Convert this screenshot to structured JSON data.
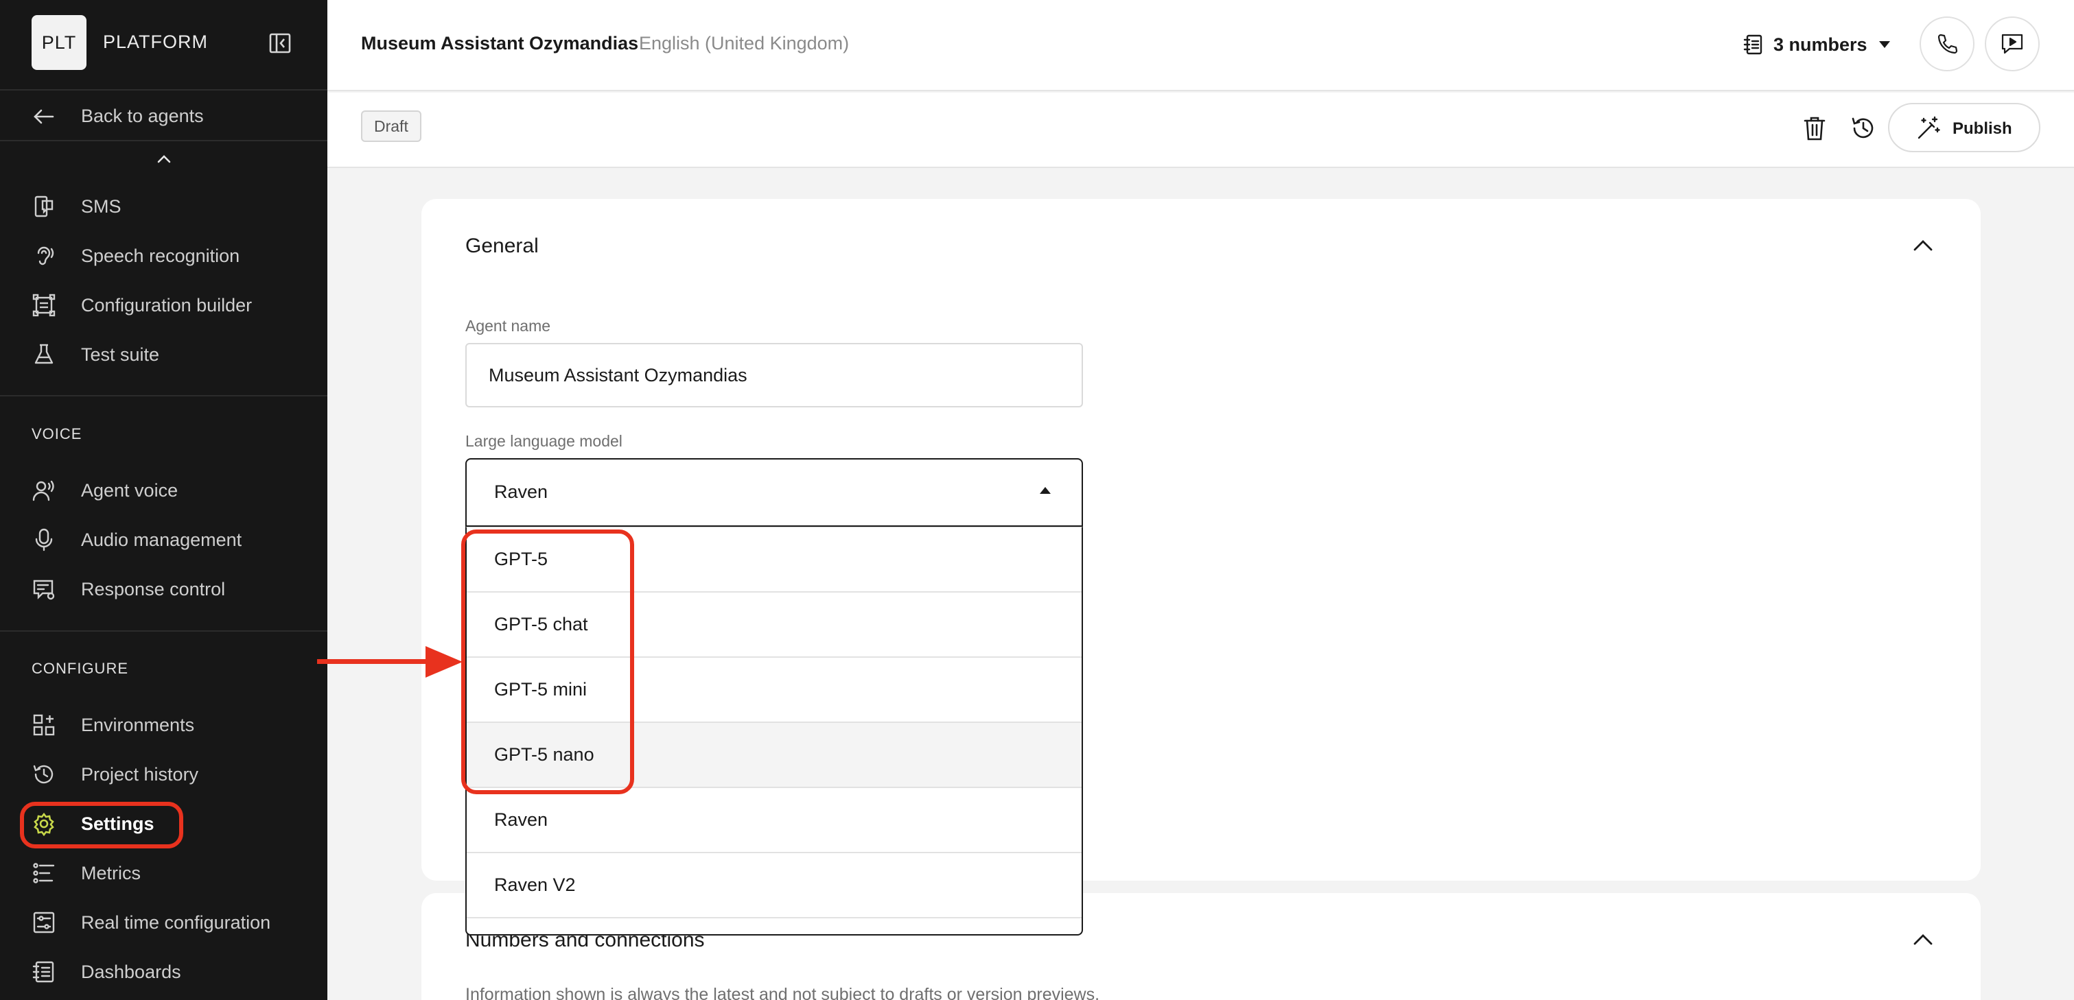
{
  "sidebar": {
    "logo": "PLT",
    "brand": "PLATFORM",
    "back_label": "Back to agents",
    "top_items": [
      {
        "label": "SMS",
        "icon": "sms-icon"
      },
      {
        "label": "Speech recognition",
        "icon": "ear-icon"
      },
      {
        "label": "Configuration builder",
        "icon": "builder-icon"
      },
      {
        "label": "Test suite",
        "icon": "flask-icon"
      }
    ],
    "voice_section": "VOICE",
    "voice_items": [
      {
        "label": "Agent voice",
        "icon": "person-voice-icon"
      },
      {
        "label": "Audio management",
        "icon": "microphone-icon"
      },
      {
        "label": "Response control",
        "icon": "response-control-icon"
      }
    ],
    "configure_section": "CONFIGURE",
    "configure_items": [
      {
        "label": "Environments",
        "icon": "environments-icon"
      },
      {
        "label": "Project history",
        "icon": "history-icon"
      },
      {
        "label": "Settings",
        "icon": "gear-icon",
        "active": true
      },
      {
        "label": "Metrics",
        "icon": "metrics-icon"
      },
      {
        "label": "Real time configuration",
        "icon": "sliders-icon"
      },
      {
        "label": "Dashboards",
        "icon": "dashboard-icon"
      }
    ],
    "settings_accent": "#c8d84a"
  },
  "header": {
    "agent_name": "Museum Assistant Ozymandias",
    "language": "English (United Kingdom)",
    "numbers_label": "3 numbers"
  },
  "toolbar": {
    "status_badge": "Draft",
    "publish_label": "Publish"
  },
  "general": {
    "title": "General",
    "agent_name_label": "Agent name",
    "agent_name_value": "Museum Assistant Ozymandias",
    "llm_label": "Large language model",
    "llm_selected": "Raven",
    "llm_options": [
      "GPT-5",
      "GPT-5 chat",
      "GPT-5 mini",
      "GPT-5 nano",
      "Raven",
      "Raven V2"
    ],
    "hovered_option": "GPT-5 nano"
  },
  "numbers_section": {
    "title": "Numbers and connections",
    "helper": "Information shown is always the latest and not subject to drafts or version previews."
  },
  "colors": {
    "annotation": "#e8321e",
    "sidebar_bg": "#171717",
    "page_bg": "#f3f3f3"
  }
}
